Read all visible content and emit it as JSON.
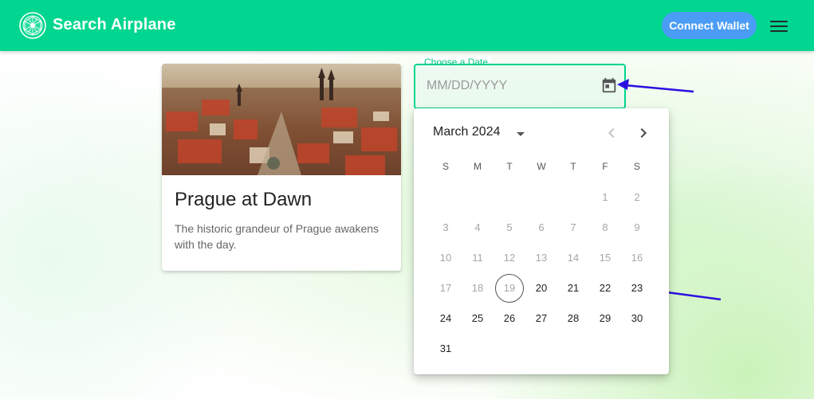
{
  "app": {
    "title": "Search Airplane",
    "connect_wallet_label": "Connect Wallet",
    "accent_color": "#00d68f",
    "button_color": "#4a9cf5"
  },
  "card": {
    "title": "Prague at Dawn",
    "description": "The historic grandeur of Prague awakens with the day."
  },
  "date_field": {
    "label": "Choose a Date",
    "placeholder": "MM/DD/YYYY",
    "value": ""
  },
  "calendar": {
    "month_label": "March 2024",
    "weekdays": [
      "S",
      "M",
      "T",
      "W",
      "T",
      "F",
      "S"
    ],
    "today": 19,
    "first_enabled": 20,
    "days": [
      [
        "",
        "",
        "",
        "",
        "",
        "1",
        "2"
      ],
      [
        "3",
        "4",
        "5",
        "6",
        "7",
        "8",
        "9"
      ],
      [
        "10",
        "11",
        "12",
        "13",
        "14",
        "15",
        "16"
      ],
      [
        "17",
        "18",
        "19",
        "20",
        "21",
        "22",
        "23"
      ],
      [
        "24",
        "25",
        "26",
        "27",
        "28",
        "29",
        "30"
      ],
      [
        "31",
        "",
        "",
        "",
        "",
        "",
        ""
      ]
    ]
  },
  "icons": {
    "logo": "globe-logo-icon",
    "menu": "hamburger-menu-icon",
    "calendar": "calendar-icon",
    "dropdown": "caret-down-icon",
    "prev": "chevron-left-icon",
    "next": "chevron-right-icon"
  },
  "annotation_color": "#2b0fe0"
}
